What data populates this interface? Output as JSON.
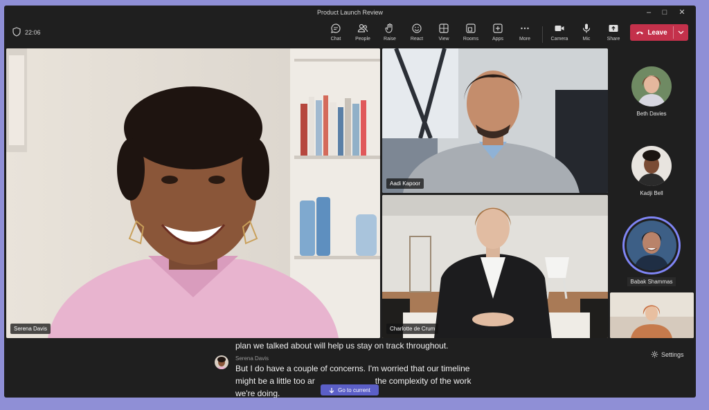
{
  "window": {
    "title": "Product Launch Review",
    "minimize_icon": "minimize-icon",
    "maximize_icon": "maximize-icon",
    "close_icon": "close-icon"
  },
  "toolbar": {
    "timer": "22:06",
    "buttons": [
      {
        "label": "Chat",
        "icon": "chat-icon"
      },
      {
        "label": "People",
        "icon": "people-icon"
      },
      {
        "label": "Raise",
        "icon": "hand-icon"
      },
      {
        "label": "React",
        "icon": "smiley-icon"
      },
      {
        "label": "View",
        "icon": "grid-icon"
      },
      {
        "label": "Rooms",
        "icon": "rooms-icon"
      },
      {
        "label": "Apps",
        "icon": "plus-square-icon"
      },
      {
        "label": "More",
        "icon": "ellipsis-icon"
      },
      {
        "label": "Camera",
        "icon": "camera-icon"
      },
      {
        "label": "Mic",
        "icon": "mic-icon"
      },
      {
        "label": "Share",
        "icon": "share-icon"
      }
    ],
    "leave_label": "Leave",
    "leave_color": "#c4314b"
  },
  "stage": {
    "main": {
      "name": "Serena Davis"
    },
    "top_right": {
      "name": "Aadi Kapoor"
    },
    "bottom_right": {
      "name": "Charlotte de Crum"
    }
  },
  "rail": {
    "participants": [
      {
        "name": "Beth Davies"
      },
      {
        "name": "Kadji Bell"
      },
      {
        "name": "Babak Shammas",
        "active_speaker": true,
        "ring_color": "#7f85f5"
      }
    ]
  },
  "captions": {
    "prev_line": "plan we talked about will help us stay on track throughout.",
    "speaker": "Serena Davis",
    "line1": "But I do have a couple of concerns. I'm worried that our timeline",
    "line2a": "might be a little too ar",
    "line2b": "the complexity of the work",
    "line3": "we're doing.",
    "goto_label": "Go to current",
    "settings_label": "Settings"
  }
}
